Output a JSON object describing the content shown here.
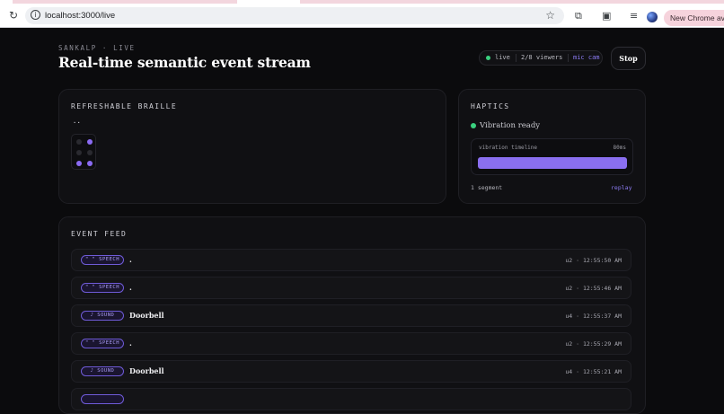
{
  "browser": {
    "url": "localhost:3000/live",
    "new_chrome_label": "New Chrome availab"
  },
  "header": {
    "eyebrow": "SANKALP · LIVE",
    "title": "Real-time semantic event stream",
    "status": {
      "live_label": "live",
      "viewers": "2/8 viewers",
      "devices": "mic cam"
    },
    "stop_label": "Stop"
  },
  "braille": {
    "title": "REFRESHABLE BRAILLE",
    "preview_text": "⠐⠂",
    "cell_dots": [
      false,
      false,
      true,
      true,
      false,
      true
    ]
  },
  "haptics": {
    "title": "HAPTICS",
    "status": "Vibration ready",
    "timeline_label": "vibration timeline",
    "duration": "80ms",
    "fill_fraction": 1.0,
    "segments": "1 segment",
    "replay_label": "replay"
  },
  "feed": {
    "title": "EVENT FEED",
    "rows": [
      {
        "badge": "\" \" SPEECH",
        "text": ".",
        "meta": "u2 · 12:55:50 AM"
      },
      {
        "badge": "\" \" SPEECH",
        "text": ".",
        "meta": "u2 · 12:55:46 AM"
      },
      {
        "badge": "♪ SOUND",
        "text": "Doorbell",
        "meta": "u4 · 12:55:37 AM"
      },
      {
        "badge": "\" \" SPEECH",
        "text": ".",
        "meta": "u2 · 12:55:29 AM"
      },
      {
        "badge": "♪ SOUND",
        "text": "Doorbell",
        "meta": "u4 · 12:55:21 AM"
      }
    ]
  },
  "colors": {
    "accent": "#8b6bf3",
    "live_green": "#3ad17f",
    "background": "#0b0b0d"
  }
}
